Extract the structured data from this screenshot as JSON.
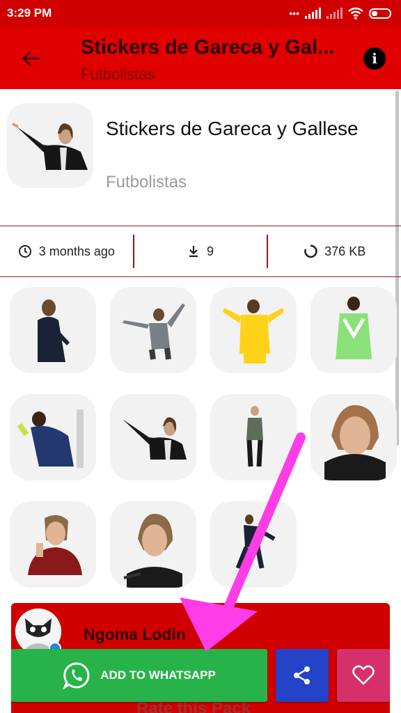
{
  "status_bar": {
    "time": "3:29 PM",
    "dots": "•••"
  },
  "app_bar": {
    "title": "Stickers de Gareca y Gal...",
    "subtitle": "Futbolistas",
    "info_glyph": "i"
  },
  "pack": {
    "name": "Stickers de Gareca y Gallese",
    "publisher": "Futbolistas"
  },
  "stats": {
    "updated": "3 months ago",
    "downloads": "9",
    "size": "376 KB",
    "updated_icon": "clock-icon",
    "downloads_icon": "download-icon",
    "size_icon": "loading-ring-icon"
  },
  "stickers": [
    {
      "id": "sticker-1"
    },
    {
      "id": "sticker-2"
    },
    {
      "id": "sticker-3"
    },
    {
      "id": "sticker-4"
    },
    {
      "id": "sticker-5"
    },
    {
      "id": "sticker-6"
    },
    {
      "id": "sticker-7"
    },
    {
      "id": "sticker-8"
    },
    {
      "id": "sticker-9"
    },
    {
      "id": "sticker-10"
    },
    {
      "id": "sticker-11"
    }
  ],
  "review": {
    "name": "Ngoma Lodin",
    "rate_label": "Rate this Pack"
  },
  "actions": {
    "add_label": "ADD TO WHATSAPP"
  },
  "colors": {
    "app_bar": "#e00000",
    "status_bar": "#d10000",
    "add_button": "#27b34a",
    "share_button": "#2543c8",
    "favorite_button": "#d6306a",
    "annotation_arrow": "#ff3de8"
  }
}
